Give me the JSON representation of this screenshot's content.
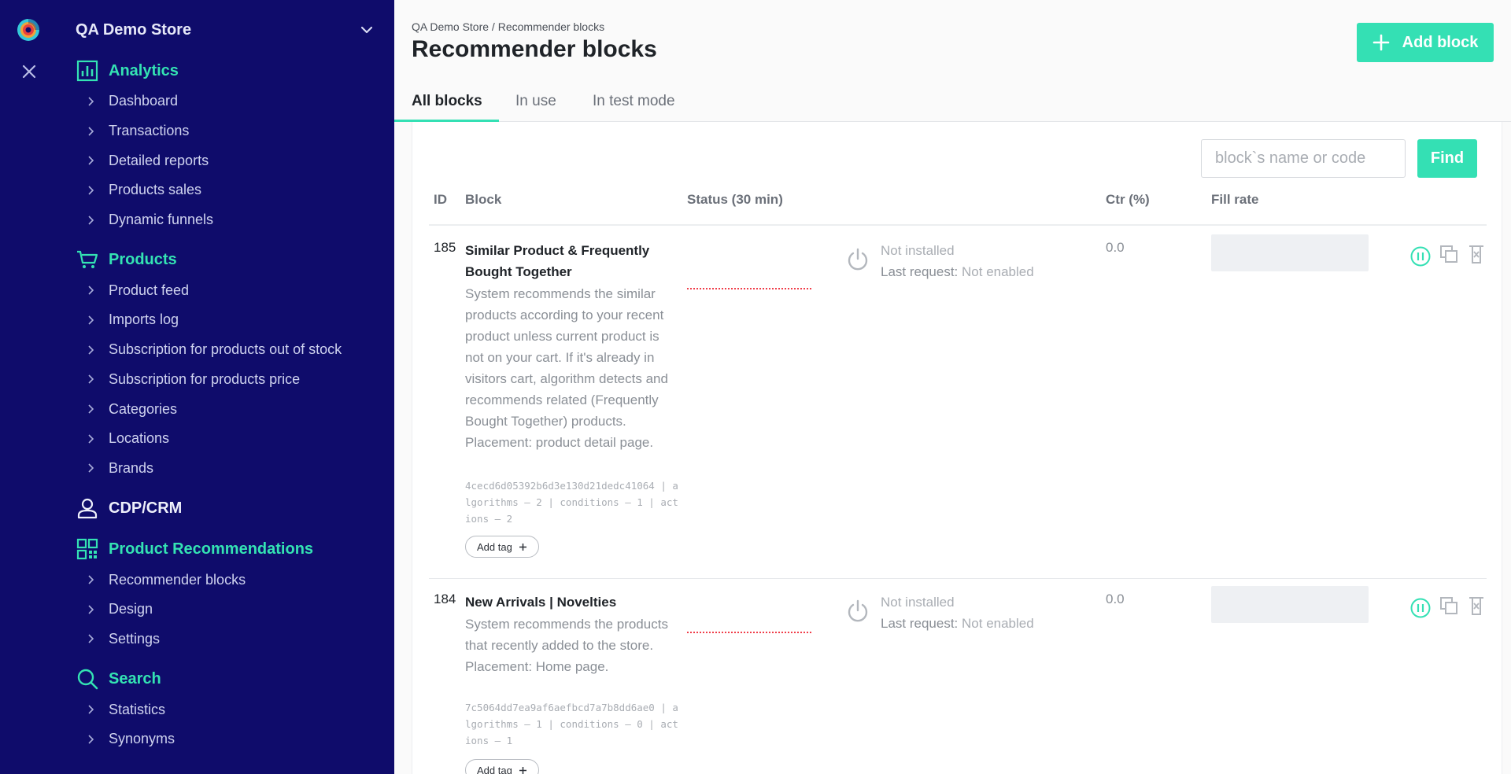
{
  "sidebar": {
    "store_name": "QA Demo Store",
    "sections": [
      {
        "label": "Analytics",
        "icon": "bar-chart-icon",
        "items": [
          "Dashboard",
          "Transactions",
          "Detailed reports",
          "Products sales",
          "Dynamic funnels"
        ]
      },
      {
        "label": "Products",
        "icon": "shopping-cart-icon",
        "items": [
          "Product feed",
          "Imports log",
          "Subscription for products out of stock",
          "Subscription for products price",
          "Categories",
          "Locations",
          "Brands"
        ]
      },
      {
        "label": "CDP/CRM",
        "icon": "user-icon",
        "items": []
      },
      {
        "label": "Product Recommendations",
        "icon": "grid-icon",
        "items": [
          "Recommender blocks",
          "Design",
          "Settings"
        ]
      },
      {
        "label": "Search",
        "icon": "search-icon",
        "items": [
          "Statistics",
          "Synonyms"
        ]
      }
    ]
  },
  "header": {
    "breadcrumb": "QA Demo Store / Recommender blocks",
    "title": "Recommender blocks",
    "add_button": "Add block"
  },
  "tabs": [
    "All blocks",
    "In use",
    "In test mode"
  ],
  "search": {
    "placeholder": "block`s name or code",
    "find_label": "Find"
  },
  "table": {
    "columns": [
      "ID",
      "Block",
      "Status (30 min)",
      "Ctr (%)",
      "Fill rate"
    ],
    "rows": [
      {
        "id": "185",
        "name": "Similar Product & Frequently Bought Together",
        "description": "System recommends the similar products according to your recent product unless current product is not on your cart. If it's already in visitors cart, algorithm detects and recommends related (Frequently Bought Together) products. Placement: product detail page.",
        "code": "4cecd6d05392b6d3e130d21dedc41064 | algorithms – 2 | conditions – 1 | actions – 2",
        "tag_button": "Add tag",
        "status": "Not installed",
        "last_request_label": "Last request:",
        "last_request_value": "Not enabled",
        "ctr": "0.0"
      },
      {
        "id": "184",
        "name": "New Arrivals | Novelties",
        "description": "System recommends the products that recently added to the store. Placement: Home page.",
        "code": "7c5064dd7ea9af6aefbcd7a7b8dd6ae0 | algorithms – 1 | conditions – 0 | actions – 1",
        "tag_button": "Add tag",
        "status": "Not installed",
        "last_request_label": "Last request:",
        "last_request_value": "Not enabled",
        "ctr": "0.0"
      }
    ]
  },
  "colors": {
    "sidebar_bg": "#0f0c6b",
    "accent": "#34e0b4",
    "status_dots": "#f03e4a"
  }
}
